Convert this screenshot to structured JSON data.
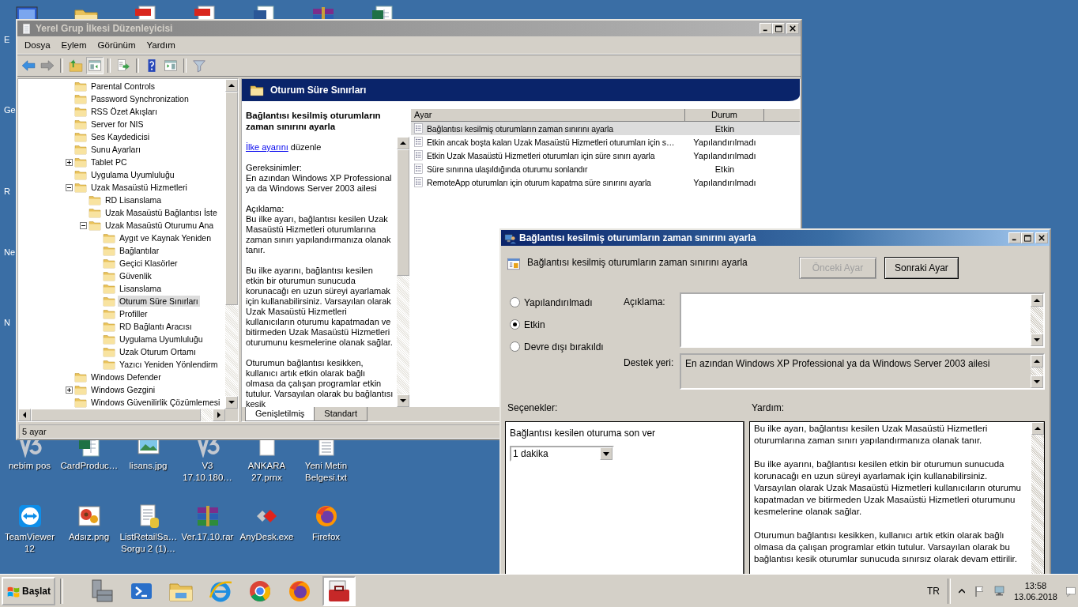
{
  "desktop": {
    "edge_labels": [
      "E",
      "Ge",
      "R",
      "Ne",
      "N"
    ],
    "top_icons": [
      {
        "kind": "computer"
      },
      {
        "kind": "folder"
      },
      {
        "kind": "pdf"
      },
      {
        "kind": "pdf"
      },
      {
        "kind": "word"
      },
      {
        "kind": "archive"
      },
      {
        "kind": "excel"
      }
    ],
    "icons": [
      {
        "label": "nebim pos",
        "kind": "v3"
      },
      {
        "label": "CardProduc…",
        "kind": "excel"
      },
      {
        "label": "lisans.jpg",
        "kind": "image"
      },
      {
        "label": "V3 17.10.180…",
        "kind": "v3"
      },
      {
        "label": "ANKARA 27.prnx",
        "kind": "blank"
      },
      {
        "label": "Yeni Metin Belgesi.txt",
        "kind": "text"
      },
      {
        "label": "TeamViewer 12",
        "kind": "teamviewer"
      },
      {
        "label": "Adsız.png",
        "kind": "flowers"
      },
      {
        "label": "ListRetailSa… Sorgu 2 (1)…",
        "kind": "dbdoc"
      },
      {
        "label": "Ver.17.10.rar",
        "kind": "archive"
      },
      {
        "label": "AnyDesk.exe",
        "kind": "anydesk"
      },
      {
        "label": "Firefox",
        "kind": "firefox"
      }
    ]
  },
  "gpedit": {
    "title": "Yerel Grup İlkesi Düzenleyicisi",
    "active": false,
    "menu": [
      "Dosya",
      "Eylem",
      "Görünüm",
      "Yardım"
    ],
    "toolbar": [
      {
        "kind": "back",
        "pressed": false
      },
      {
        "kind": "forward",
        "pressed": false
      },
      {
        "kind": "separator"
      },
      {
        "kind": "upfolder",
        "pressed": false
      },
      {
        "kind": "tree",
        "pressed": true
      },
      {
        "kind": "separator"
      },
      {
        "kind": "export",
        "pressed": false
      },
      {
        "kind": "separator"
      },
      {
        "kind": "help",
        "pressed": false
      },
      {
        "kind": "actionpane",
        "pressed": false
      },
      {
        "kind": "separator"
      },
      {
        "kind": "filter",
        "pressed": false
      }
    ],
    "tree": [
      {
        "label": "Parental Controls",
        "selected": false
      },
      {
        "label": "Password Synchronization",
        "selected": false
      },
      {
        "label": "RSS Özet Akışları",
        "selected": false
      },
      {
        "label": "Server for NIS",
        "selected": false
      },
      {
        "label": "Ses Kaydedicisi",
        "selected": false
      },
      {
        "label": "Sunu Ayarları",
        "selected": false
      },
      {
        "label": "Tablet PC",
        "selected": false,
        "expanded": false
      },
      {
        "label": "Uygulama Uyumluluğu",
        "selected": false
      },
      {
        "label": "Uzak Masaüstü Hizmetleri",
        "selected": false,
        "expanded": true,
        "children": [
          {
            "label": "RD Lisanslama",
            "selected": false
          },
          {
            "label": "Uzak Masaüstü Bağlantısı İste",
            "selected": false
          },
          {
            "label": "Uzak Masaüstü Oturumu Ana",
            "selected": false,
            "expanded": true,
            "children": [
              {
                "label": "Aygıt ve Kaynak Yeniden",
                "selected": false
              },
              {
                "label": "Bağlantılar",
                "selected": false
              },
              {
                "label": "Geçici Klasörler",
                "selected": false
              },
              {
                "label": "Güvenlik",
                "selected": false
              },
              {
                "label": "Lisanslama",
                "selected": false
              },
              {
                "label": "Oturum Süre Sınırları",
                "selected": true
              },
              {
                "label": "Profiller",
                "selected": false
              },
              {
                "label": "RD Bağlantı Aracısı",
                "selected": false
              },
              {
                "label": "Uygulama Uyumluluğu",
                "selected": false
              },
              {
                "label": "Uzak Oturum Ortamı",
                "selected": false
              },
              {
                "label": "Yazıcı Yeniden Yönlendirm",
                "selected": false
              }
            ]
          }
        ]
      },
      {
        "label": "Windows Defender",
        "selected": false
      },
      {
        "label": "Windows Gezgini",
        "selected": false,
        "expanded": false
      },
      {
        "label": "Windows Güvenilirlik Çözümlemesi",
        "selected": false
      }
    ],
    "header": "Oturum Süre Sınırları",
    "description": {
      "title": "Bağlantısı kesilmiş oturumların zaman sınırını ayarla",
      "edit_link": "İlke ayarını",
      "edit_text": "düzenle",
      "requirements_label": "Gereksinimler:",
      "requirements": "En azından Windows XP Professional ya da Windows Server 2003 ailesi",
      "explanation_label": "Açıklama:",
      "paragraphs": [
        "Bu ilke ayarı, bağlantısı kesilen Uzak Masaüstü Hizmetleri oturumlarına zaman sınırı yapılandırmanıza olanak tanır.",
        "Bu ilke ayarını, bağlantısı kesilen etkin bir oturumun sunucuda korunacağı en uzun süreyi ayarlamak için kullanabilirsiniz. Varsayılan olarak Uzak Masaüstü Hizmetleri kullanıcıların oturumu kapatmadan ve bitirmeden Uzak Masaüstü Hizmetleri oturumunu kesmelerine olanak sağlar.",
        "Oturumun bağlantısı kesikken, kullanıcı artık etkin olarak bağlı olmasa da çalışan programlar etkin tutulur. Varsayılan olarak bu bağlantısı kesik"
      ]
    },
    "list": {
      "columns": [
        "Ayar",
        "Durum"
      ],
      "rows": [
        {
          "name": "Bağlantısı kesilmiş oturumların zaman sınırını ayarla",
          "status": "Etkin",
          "selected": true
        },
        {
          "name": "Etkin ancak boşta kalan Uzak Masaüstü Hizmetleri oturumları için s…",
          "status": "Yapılandırılmadı",
          "selected": false
        },
        {
          "name": "Etkin Uzak Masaüstü Hizmetleri oturumları için süre sınırı ayarla",
          "status": "Yapılandırılmadı",
          "selected": false
        },
        {
          "name": "Süre sınırına ulaşıldığında oturumu sonlandır",
          "status": "Etkin",
          "selected": false
        },
        {
          "name": "RemoteApp oturumları için oturum kapatma süre sınırını ayarla",
          "status": "Yapılandırılmadı",
          "selected": false
        }
      ]
    },
    "tabs": [
      {
        "label": "Genişletilmiş",
        "selected": true
      },
      {
        "label": "Standart",
        "selected": false
      }
    ],
    "status_bar": "5 ayar"
  },
  "dialog": {
    "title": "Bağlantısı kesilmiş oturumların zaman sınırını ayarla",
    "active": true,
    "heading": "Bağlantısı kesilmiş oturumların zaman sınırını ayarla",
    "buttons": [
      {
        "label": "Önceki Ayar",
        "disabled": true
      },
      {
        "label": "Sonraki Ayar",
        "disabled": false
      }
    ],
    "states": [
      {
        "label": "Yapılandırılmadı",
        "selected": false
      },
      {
        "label": "Etkin",
        "selected": true
      },
      {
        "label": "Devre dışı bırakıldı",
        "selected": false
      }
    ],
    "comment_label": "Açıklama:",
    "supported_label": "Destek yeri:",
    "supported": "En azından Windows XP Professional ya da Windows Server 2003 ailesi",
    "options_label": "Seçenekler:",
    "help_label": "Yardım:",
    "option": {
      "label": "Bağlantısı kesilen oturuma son ver",
      "value": "1 dakika"
    },
    "help": [
      "Bu ilke ayarı, bağlantısı kesilen Uzak Masaüstü Hizmetleri oturumlarına zaman sınırı yapılandırmanıza olanak tanır.",
      "Bu ilke ayarını, bağlantısı kesilen etkin bir oturumun sunucuda korunacağı en uzun süreyi ayarlamak için kullanabilirsiniz. Varsayılan olarak Uzak Masaüstü Hizmetleri kullanıcıların oturumu kapatmadan ve bitirmeden Uzak Masaüstü Hizmetleri oturumunu kesmelerine olanak sağlar.",
      "Oturumun bağlantısı kesikken, kullanıcı artık etkin olarak bağlı olmasa da çalışan programlar etkin tutulur. Varsayılan olarak bu bağlantısı kesik oturumlar sunucuda sınırsız olarak devam ettirilir."
    ]
  },
  "taskbar": {
    "start": "Başlat",
    "apps": [
      {
        "kind": "server",
        "selected": false
      },
      {
        "kind": "powershell",
        "selected": false
      },
      {
        "kind": "explorer",
        "selected": false
      },
      {
        "kind": "ie",
        "selected": false
      },
      {
        "kind": "chrome",
        "selected": false
      },
      {
        "kind": "firefox",
        "selected": false
      },
      {
        "kind": "toolbox",
        "selected": true
      }
    ],
    "language": "TR",
    "time": "13:58",
    "date": "13.06.2018"
  }
}
